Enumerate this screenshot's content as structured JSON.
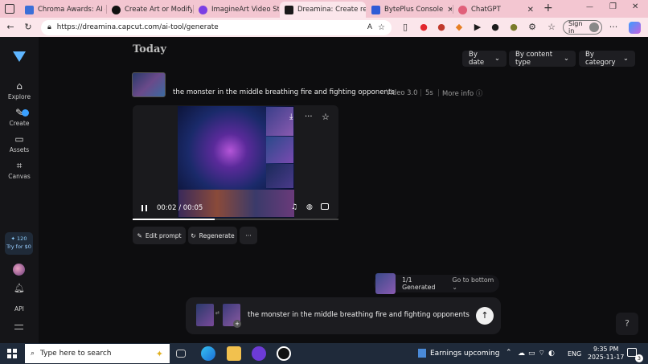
{
  "browser": {
    "tabs": [
      {
        "label": "Chroma Awards: AI c",
        "fav": "#3a6fd8"
      },
      {
        "label": "Create Art or Modify",
        "fav": "#111111"
      },
      {
        "label": "ImagineArt Video St",
        "fav": "#7b3fe4"
      },
      {
        "label": "Dreamina: Create re",
        "fav": "#1a1a1a"
      },
      {
        "label": "BytePlus Console",
        "fav": "#2f5bd6"
      },
      {
        "label": "ChatGPT",
        "fav": "#e0607a"
      }
    ],
    "new_tab": "+",
    "url": "https://dreamina.capcut.com/ai-tool/generate",
    "sign_in": "Sign in",
    "win_min": "—",
    "win_max": "❐",
    "win_close": "✕"
  },
  "sidebar": {
    "items": [
      {
        "label": "Explore",
        "icon": "⌂"
      },
      {
        "label": "Create",
        "icon": "✎"
      },
      {
        "label": "Assets",
        "icon": "▭"
      },
      {
        "label": "Canvas",
        "icon": "⌗"
      }
    ],
    "credits": "120",
    "try_label": "Try for $0",
    "api": "API"
  },
  "main": {
    "heading": "Today",
    "filters": [
      "By date",
      "By content type",
      "By category"
    ],
    "prompt": "the monster in the middle breathing fire and fighting opponents",
    "model": "Video 3.0",
    "duration": "5s",
    "more_info": "More info",
    "player": {
      "time": "00:02 / 00:05",
      "progress": 0.4
    },
    "actions": {
      "edit": "Edit prompt",
      "regenerate": "Regenerate",
      "more": "···"
    }
  },
  "bottom": {
    "generated": "1/1 Generated",
    "go_bottom": "Go to bottom",
    "prompt_value": "the monster in the middle breathing fire and fighting opponents"
  },
  "taskbar": {
    "search_placeholder": "Type here to search",
    "news": "Earnings upcoming",
    "lang": "ENG",
    "time": "9:35 PM",
    "date": "2025-11-17",
    "notif": "3"
  },
  "colors": {
    "accent": "#3aa0ff",
    "tabstrip": "#f3c6d1",
    "page_bg": "#0d0d0f"
  }
}
